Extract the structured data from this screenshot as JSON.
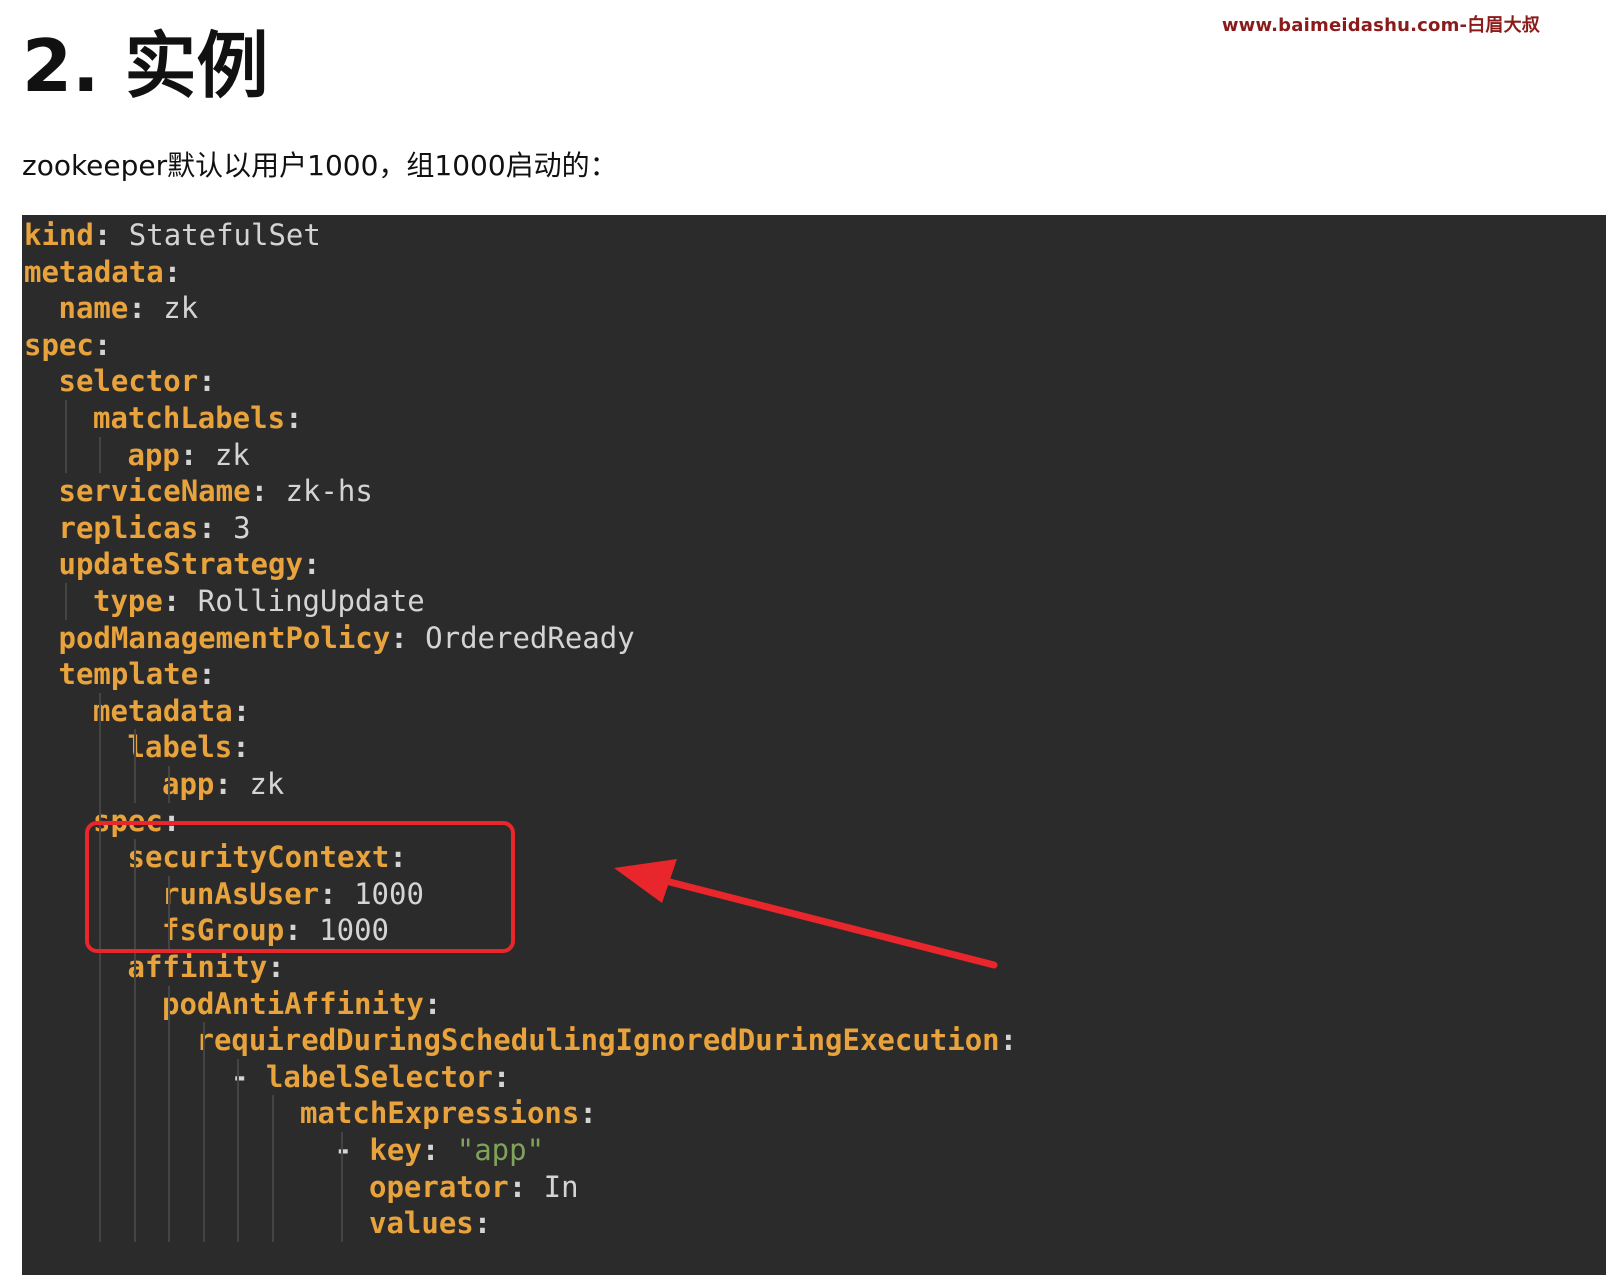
{
  "watermark": "www.baimeidashu.com-白眉大叔",
  "heading": "2. 实例",
  "intro": "zookeeper默认以用户1000，组1000启动的：",
  "code": {
    "lines": [
      {
        "indent": 0,
        "key": "kind",
        "value": "StatefulSet"
      },
      {
        "indent": 0,
        "key": "metadata",
        "value": ""
      },
      {
        "indent": 1,
        "key": "name",
        "value": "zk"
      },
      {
        "indent": 0,
        "key": "spec",
        "value": ""
      },
      {
        "indent": 1,
        "key": "selector",
        "value": ""
      },
      {
        "indent": 2,
        "key": "matchLabels",
        "value": ""
      },
      {
        "indent": 3,
        "key": "app",
        "value": "zk"
      },
      {
        "indent": 1,
        "key": "serviceName",
        "value": "zk-hs"
      },
      {
        "indent": 1,
        "key": "replicas",
        "value": "3"
      },
      {
        "indent": 1,
        "key": "updateStrategy",
        "value": ""
      },
      {
        "indent": 2,
        "key": "type",
        "value": "RollingUpdate"
      },
      {
        "indent": 1,
        "key": "podManagementPolicy",
        "value": "OrderedReady"
      },
      {
        "indent": 1,
        "key": "template",
        "value": ""
      },
      {
        "indent": 2,
        "key": "metadata",
        "value": ""
      },
      {
        "indent": 3,
        "key": "labels",
        "value": ""
      },
      {
        "indent": 4,
        "key": "app",
        "value": "zk"
      },
      {
        "indent": 2,
        "key": "spec",
        "value": ""
      },
      {
        "indent": 3,
        "key": "securityContext",
        "value": ""
      },
      {
        "indent": 4,
        "key": "runAsUser",
        "value": "1000"
      },
      {
        "indent": 4,
        "key": "fsGroup",
        "value": "1000"
      },
      {
        "indent": 3,
        "key": "affinity",
        "value": ""
      },
      {
        "indent": 4,
        "key": "podAntiAffinity",
        "value": ""
      },
      {
        "indent": 5,
        "key": "requiredDuringSchedulingIgnoredDuringExecution",
        "value": ""
      },
      {
        "indent": 6,
        "dash": true,
        "key": "labelSelector",
        "value": ""
      },
      {
        "indent": 8,
        "key": "matchExpressions",
        "value": ""
      },
      {
        "indent": 9,
        "dash": true,
        "key": "key",
        "value": "\"app\"",
        "string": true
      },
      {
        "indent": 10,
        "key": "operator",
        "value": "In"
      },
      {
        "indent": 10,
        "key": "values",
        "value": ""
      }
    ]
  },
  "annotation": {
    "box_color": "#e8262b",
    "arrow_color": "#e8262b",
    "highlighted_keys": [
      "securityContext",
      "runAsUser",
      "fsGroup"
    ]
  }
}
